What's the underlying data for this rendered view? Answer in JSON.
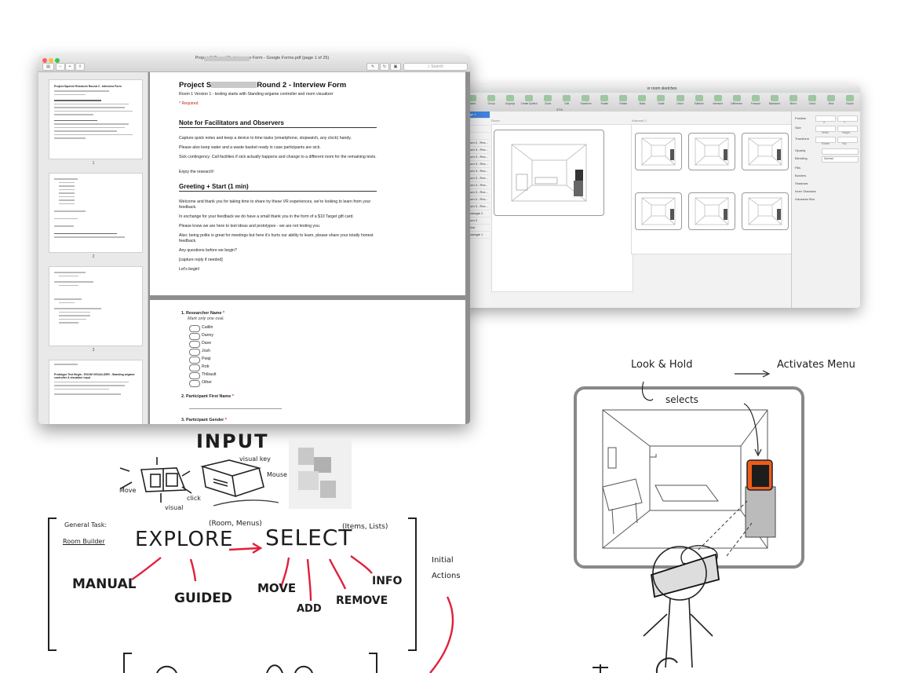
{
  "pdf_window": {
    "title": "Project S                    Round 2 - Interview Form - Google Forms.pdf (page 1 of 25)",
    "search_placeholder": "Search",
    "thumbnails": [
      {
        "title": "Project Squirrel Research Round 2 - Interview Form",
        "page_number": "1"
      },
      {
        "page_number": "2"
      },
      {
        "page_number": "3"
      },
      {
        "title": "Prototype Test Begin - ROOM VISUALIZER - Standing w/game controller & visualizer input"
      }
    ],
    "page1": {
      "title_prefix": "Project S",
      "title_suffix": "Round 2 - Interview Form",
      "subtitle": "Room 1 Version 1 - testing starts with Standing w/game controller and room visualizer",
      "required": "* Required",
      "section1_heading": "Note for Facilitators and Observers",
      "section1_paragraphs": [
        "Capture quick notes and keep a device to time tasks (smartphone, stopwatch, any clock) handy.",
        "Please also keep water and a waste basket ready in case participants are sick.",
        "Sick contingency: Call facilities if sick actually happens and change to a different room for the remaining tests.",
        "Enjoy the research!"
      ],
      "section2_heading": "Greeting + Start (1 min)",
      "section2_paragraphs": [
        "Welcome and thank you for taking time to share try these VR experiences, we're looking to learn from your feedback.",
        "In exchange for your feedback we do have a small thank you in the form of a $10 Target gift card.",
        "Please know we are here to test ideas and prototypes - we are not testing you.",
        "Also: being polite is great for meetings but here it's hurts our ability to learn, please share your totally honest feedback.",
        "Any questions before we begin?",
        "[capture reply if needed]",
        "Let's begin!"
      ]
    },
    "page2": {
      "q1_title": "1.  Researcher Name",
      "q1_required": "*",
      "q1_hint": "Mark only one oval.",
      "q1_options": [
        "Caitlin",
        "Danny",
        "Dave",
        "Josh",
        "Peiqi",
        "Rob",
        "Thibault",
        "Other"
      ],
      "q2_title": "2.  Participant First Name",
      "q2_required": "*",
      "q3_title": "3.  Participant Gender",
      "q3_required": "*"
    }
  },
  "sketch_window": {
    "title": "vr room sketches",
    "toolbar": [
      "Insert",
      "Group",
      "Ungroup",
      "Create Symbol",
      "Zoom",
      "Edit",
      "Transform",
      "Rotate",
      "Flatten",
      "Mask",
      "Scale",
      "Union",
      "Subtract",
      "Intersect",
      "Difference",
      "Forward",
      "Backward",
      "Mirror",
      "Cloud",
      "View",
      "Export"
    ],
    "zoom_value": "37%",
    "layers": [
      "Page 1",
      "",
      "",
      "",
      "Room 2 - Rec...",
      "Room 3 - Rec...",
      "Room 3 - Rec...",
      "Room 3 - Rec...",
      "Room 3 - Rec...",
      "Room 3 - Rec...",
      "Room 3 - Rec...",
      "Room 3 - Rec...",
      "Room 3 - Rec...",
      "Room 3 - Rec...",
      "Rectangle 2",
      "Room 3",
      "Thrive",
      "Rectangle 1"
    ],
    "artboard_labels": [
      "Room",
      "Artboard 2"
    ],
    "inspector": [
      "Position",
      "Size",
      "Transform",
      "Opacity",
      "Blending",
      "Fills",
      "Borders",
      "Shadows",
      "Inner Shadows",
      "Gaussian Blur"
    ],
    "inspector_subs": [
      "X",
      "Y",
      "Width",
      "Height",
      "Rotate",
      "Flip"
    ],
    "blending_value": "Normal"
  },
  "sketch_notes": {
    "input": "INPUT",
    "visual_key": "visual key",
    "mouse": "Mouse",
    "move": "Move",
    "click": "click",
    "visual": "visual",
    "general_task": "General Task:",
    "room_builder": "Room Builder",
    "explore": "EXPLORE",
    "room_menus": "(Room, Menus)",
    "select": "SELECT",
    "items_lists": "(Items, Lists)",
    "manual": "MANUAL",
    "guided": "GUIDED",
    "move_caps": "MOVE",
    "add": "ADD",
    "remove": "REMOVE",
    "info": "INFO",
    "initial_actions": "Initial Actions",
    "look_hold": "Look & Hold",
    "activates_menu": "Activates Menu",
    "selects": "selects"
  },
  "colors": {
    "accent_red": "#e0203a",
    "orange": "#ee5c1a",
    "required_red": "#cc2222",
    "selection_blue": "#3f82e0"
  }
}
